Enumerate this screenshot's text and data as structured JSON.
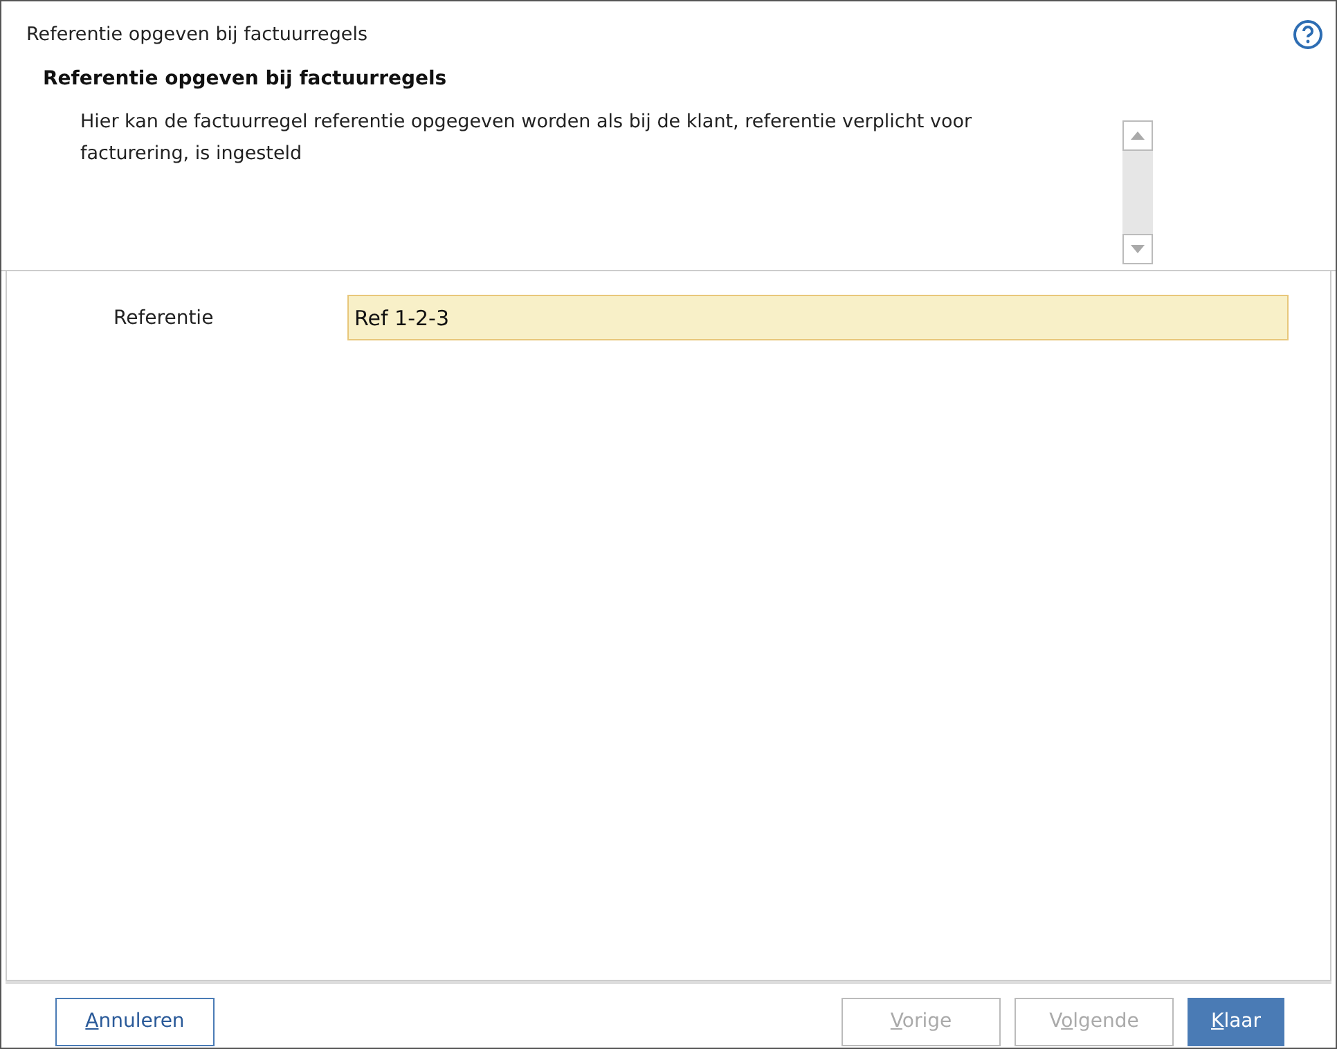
{
  "window": {
    "title": "Referentie opgeven bij factuurregels"
  },
  "header": {
    "title": "Referentie opgeven bij factuurregels",
    "description": "Hier kan de factuurregel referentie opgegeven worden als bij de klant, referentie verplicht voor facturering, is ingesteld"
  },
  "form": {
    "fields": [
      {
        "label": "Referentie",
        "value": "Ref 1-2-3",
        "focused": true
      }
    ]
  },
  "buttons": [
    {
      "kind": "secondary",
      "key": "A",
      "after": "nnuleren",
      "disabled": false
    },
    {
      "kind": "secondary",
      "key": "V",
      "after": "orige",
      "disabled": true
    },
    {
      "kind": "secondary",
      "before": "V",
      "key": "o",
      "after": "lgende",
      "disabled": true
    },
    {
      "kind": "primary",
      "key": "K",
      "after": "laar",
      "disabled": false
    }
  ]
}
